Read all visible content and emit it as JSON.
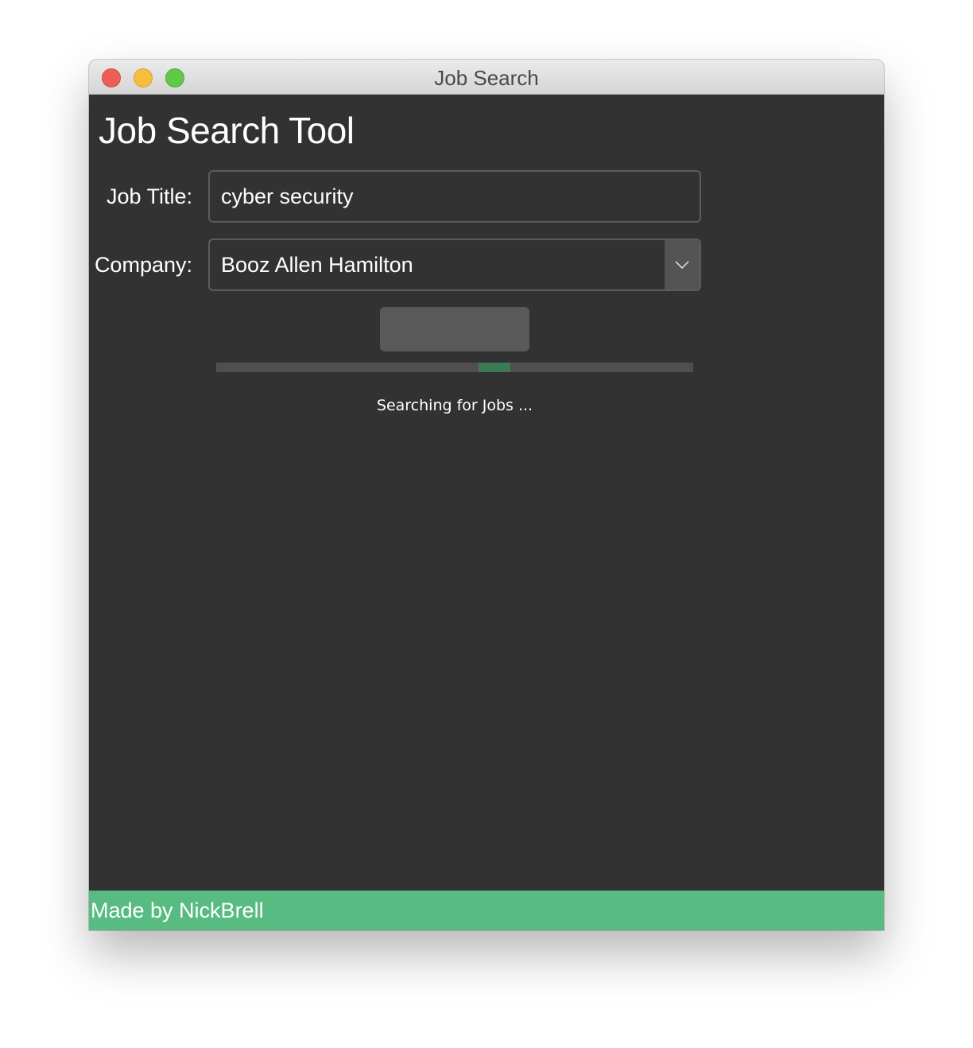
{
  "window": {
    "title": "Job Search"
  },
  "app": {
    "heading": "Job Search Tool"
  },
  "form": {
    "job_title_label": "Job Title:",
    "job_title_value": "cyber security",
    "company_label": "Company:",
    "company_selected": "Booz Allen Hamilton",
    "search_button_label": ""
  },
  "progress": {
    "mode": "indeterminate",
    "indicator_position_fraction": 0.55,
    "status_text": "Searching for Jobs ..."
  },
  "footer": {
    "credit": "Made by NickBrell"
  },
  "colors": {
    "background": "#323232",
    "accent": "#57bb82",
    "progress_indicator": "#3b7a55"
  },
  "icons": {
    "select_arrow": "chevron-down-icon"
  }
}
